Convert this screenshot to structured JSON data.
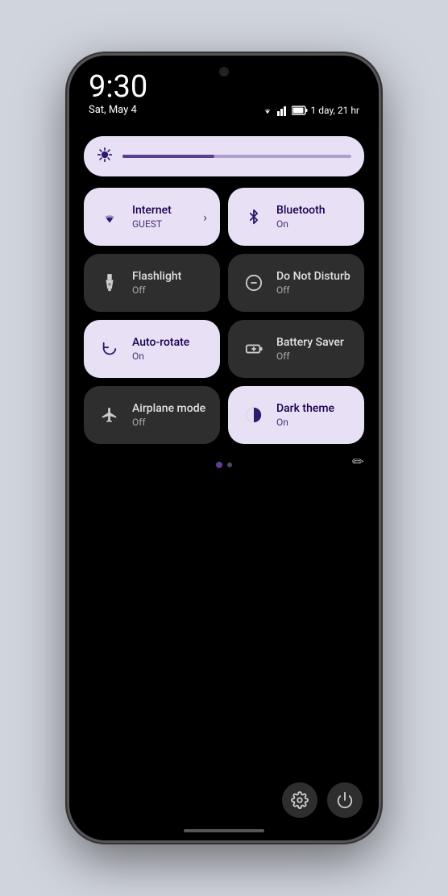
{
  "status": {
    "time": "9:30",
    "date": "Sat, May 4",
    "battery_text": "1 day, 21 hr"
  },
  "brightness": {
    "icon": "☀"
  },
  "tiles": [
    {
      "id": "internet",
      "title": "Internet",
      "subtitle": "GUEST",
      "icon": "wifi",
      "state": "active",
      "has_arrow": true
    },
    {
      "id": "bluetooth",
      "title": "Bluetooth",
      "subtitle": "On",
      "icon": "bluetooth",
      "state": "active",
      "has_arrow": false
    },
    {
      "id": "flashlight",
      "title": "Flashlight",
      "subtitle": "Off",
      "icon": "flashlight",
      "state": "inactive",
      "has_arrow": false
    },
    {
      "id": "do-not-disturb",
      "title": "Do Not Disturb",
      "subtitle": "Off",
      "icon": "dnd",
      "state": "inactive",
      "has_arrow": false
    },
    {
      "id": "auto-rotate",
      "title": "Auto-rotate",
      "subtitle": "On",
      "icon": "rotate",
      "state": "active",
      "has_arrow": false
    },
    {
      "id": "battery-saver",
      "title": "Battery Saver",
      "subtitle": "Off",
      "icon": "battery",
      "state": "inactive",
      "has_arrow": false
    },
    {
      "id": "airplane-mode",
      "title": "Airplane mode",
      "subtitle": "Off",
      "icon": "airplane",
      "state": "inactive",
      "has_arrow": false
    },
    {
      "id": "dark-theme",
      "title": "Dark theme",
      "subtitle": "On",
      "icon": "dark",
      "state": "active",
      "has_arrow": false
    }
  ],
  "bottom": {
    "settings_icon": "⚙",
    "power_icon": "⏻",
    "edit_icon": "✏"
  }
}
